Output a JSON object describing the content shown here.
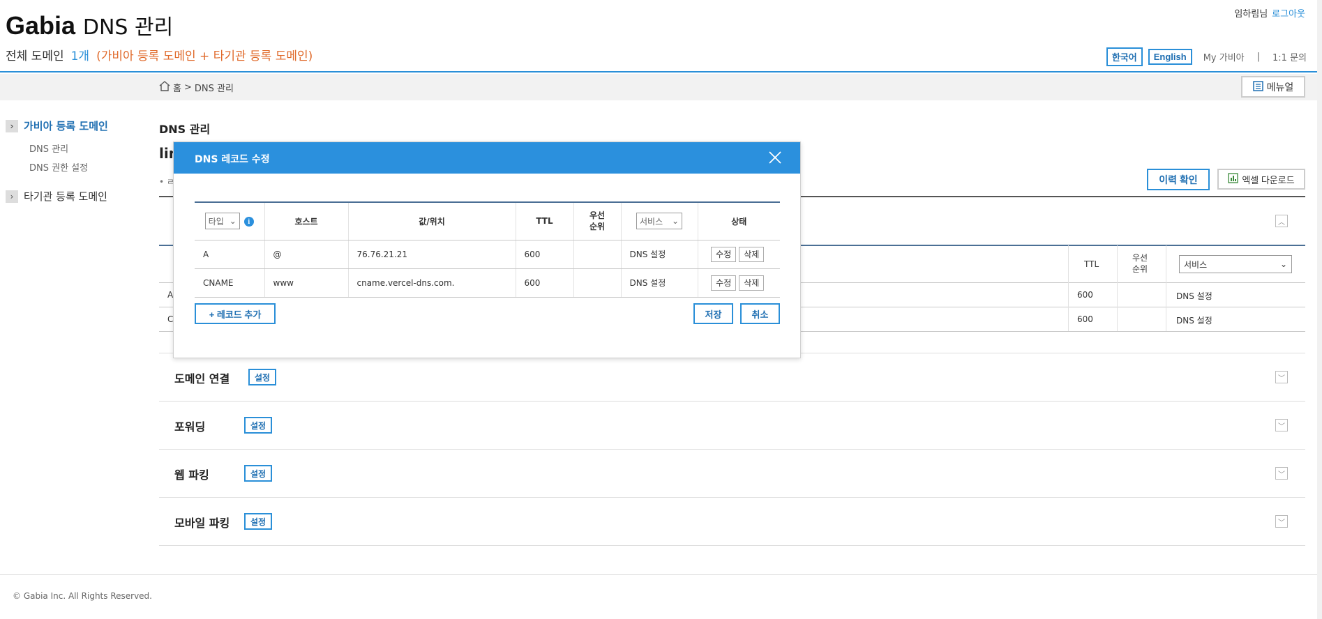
{
  "header": {
    "brand": "Gabia",
    "title": "DNS 관리",
    "summary_label": "전체 도메인",
    "summary_count": "1개",
    "summary_note": "(가비아 등록 도메인 + 타기관 등록 도메인)",
    "user_name": "임하림님",
    "logout": "로그아웃",
    "lang_ko": "한국어",
    "lang_en": "English",
    "my_gabia": "My 가비아",
    "separator": "|",
    "inquiry": "1:1 문의"
  },
  "breadcrumb": {
    "home": "홈",
    "sep": ">",
    "current": "DNS 관리",
    "manual": "메뉴얼"
  },
  "sidebar": {
    "group1": "가비아 등록 도메인",
    "sub1": "DNS 관리",
    "sub2": "DNS 권한 설정",
    "group2": "타기관 등록 도메인"
  },
  "main": {
    "title": "DNS 관리",
    "domain_prefix": "lin",
    "bullet": "• ㄹ",
    "history_button": "이력 확인",
    "excel_button": "엑셀 다운로드",
    "bg_table": {
      "ttl_header": "TTL",
      "priority_header": "우선\n순위",
      "service_select": "서비스",
      "rows": [
        {
          "type_initial": "A",
          "ttl": "600",
          "service": "DNS 설정"
        },
        {
          "type_initial": "C",
          "ttl": "600",
          "service": "DNS 설정"
        }
      ]
    },
    "sections": [
      {
        "label": "도메인 연결",
        "button": "설정"
      },
      {
        "label": "포워딩",
        "button": "설정"
      },
      {
        "label": "웹 파킹",
        "button": "설정"
      },
      {
        "label": "모바일 파킹",
        "button": "설정"
      }
    ]
  },
  "modal": {
    "title": "DNS 레코드 수정",
    "close_icon": "close-icon",
    "headers": {
      "type": "타입",
      "host": "호스트",
      "value": "값/위치",
      "ttl": "TTL",
      "priority_1": "우선",
      "priority_2": "순위",
      "service": "서비스",
      "status": "상태"
    },
    "records": [
      {
        "type": "A",
        "host": "@",
        "value": "76.76.21.21",
        "ttl": "600",
        "priority": "",
        "service": "DNS 설정",
        "edit": "수정",
        "delete": "삭제"
      },
      {
        "type": "CNAME",
        "host": "www",
        "value": "cname.vercel-dns.com.",
        "ttl": "600",
        "priority": "",
        "service": "DNS 설정",
        "edit": "수정",
        "delete": "삭제"
      }
    ],
    "add_record": "+ 레코드 추가",
    "save": "저장",
    "cancel": "취소"
  },
  "footer": {
    "copyright": "© Gabia Inc. All Rights Reserved."
  },
  "colors": {
    "accent": "#2b90dd",
    "link": "#1f6fb2",
    "note": "#e06a2b"
  }
}
